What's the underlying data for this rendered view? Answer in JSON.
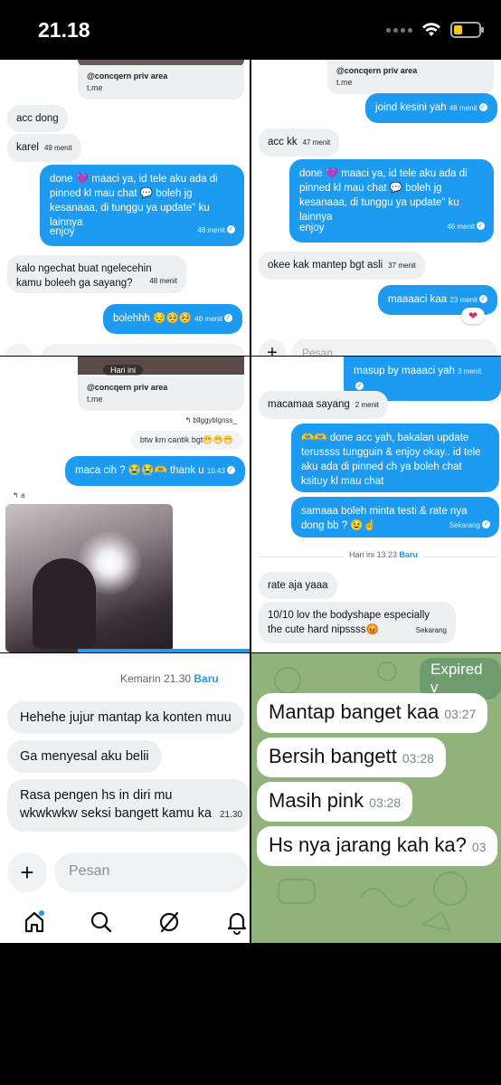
{
  "status_bar": {
    "time": "21.18"
  },
  "panel1": {
    "card_title": "@concqern priv area",
    "card_sub": "t.me",
    "msg1": "acc dong",
    "msg2": "karel",
    "msg2_time": "49 menit",
    "out1_text": "done 💜 maaci ya, id tele aku ada di pinned kl mau chat 💬 boleh jg kesanaaa, di tunggu ya update\" ku lainnya",
    "out1_enjoy": "enjoy",
    "out1_time": "48 menit",
    "msg3": "kalo ngechat buat ngelecehin kamu boleeh ga sayang?",
    "msg3_time": "48 menit",
    "out2_text": "bolehhh 😔🥺🥺",
    "out2_time": "48 menit",
    "compose_placeholder": "Pesan"
  },
  "panel2": {
    "card_title": "@concqern priv area",
    "card_sub": "t.me",
    "out1_text": "joind kesini yah",
    "out1_time": "48 menit",
    "msg1": "acc kk",
    "msg1_time": "47 menit",
    "out2_text": "done 💜 maaci ya, id tele aku ada di pinned kl mau chat 💬 boleh jg kesanaaa, di tunggu ya update\" ku lainnya",
    "out2_enjoy": "enjoy",
    "out2_time": "46 menit",
    "msg2": "okee kak mantep bgt asli",
    "msg2_time": "37 menit",
    "out3_text": "maaaaci kaa",
    "out3_time": "23 menit",
    "reaction": "❤",
    "compose_placeholder": "Pesan"
  },
  "panel3": {
    "day_label": "Hari ini",
    "card_title": "@concqern priv area",
    "card_sub": "t.me",
    "reply_user": "bllggyblgnss_",
    "reply_quote": "btw km cantik bgt😁😁😁",
    "out1_text": "maca cih ? 😭😭🫶",
    "out1_thanks": "thank u",
    "out1_time": "10.43",
    "reply2_user": "a"
  },
  "panel4": {
    "out1_text": "masup by maaaci yah",
    "out1_time": "3 menit",
    "msg1": "macamaa sayang",
    "msg1_time": "2 menit",
    "out2_text": "🫶🫶 done acc yah, bakalan update terussss tungguin & enjoy okay.. id tele aku ada di pinned ch ya boleh chat ksituy kl mau chat",
    "out3_text": "samaaa boleh minta testi & rate nya dong bb ? 😉☝",
    "out3_time": "Sekarang",
    "divider": "Hari ini 13.23",
    "divider_new": "Baru",
    "msg2": "rate aja yaaa",
    "msg3": "10/10 lov the bodyshape especially the cute hard nipssss😡",
    "msg3_time": "Sekarang"
  },
  "panel5": {
    "divider": "Kemarin 21.30",
    "divider_new": "Baru",
    "msg1": "Hehehe jujur mantap ka konten muu",
    "msg2": "Ga menyesal aku belii",
    "msg3": "Rasa pengen hs in diri mu wkwkwkw seksi bangett kamu ka",
    "msg3_time": "21.30",
    "compose_placeholder": "Pesan"
  },
  "panel6": {
    "expired": "Expired v",
    "msgs": [
      {
        "text": "Mantap banget kaa",
        "time": "03:27"
      },
      {
        "text": "Bersih bangett",
        "time": "03:28"
      },
      {
        "text": "Masih pink",
        "time": "03:28"
      },
      {
        "text": "Hs nya jarang kah ka?",
        "time": "03"
      }
    ]
  },
  "colors": {
    "accent": "#1d9bf0",
    "telegram_bg": "#8fb37a",
    "battery": "#f5c518"
  },
  "icons": [
    "wifi-icon",
    "battery-icon",
    "plus-icon",
    "home-icon",
    "search-icon",
    "grok-icon",
    "bell-icon",
    "mic-icon"
  ]
}
